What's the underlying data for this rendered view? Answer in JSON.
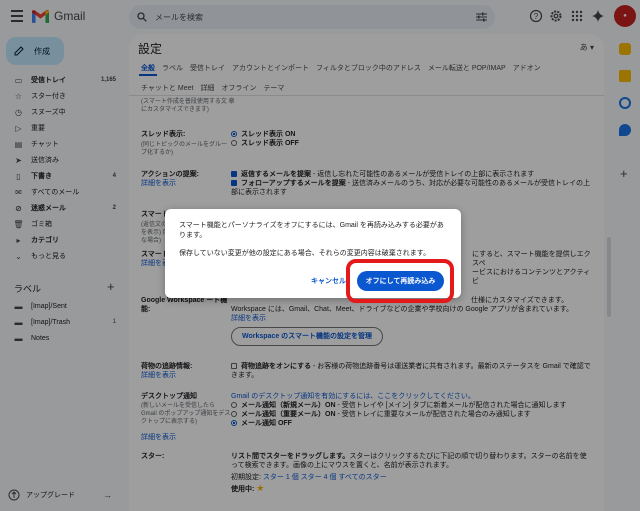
{
  "app": {
    "name": "Gmail"
  },
  "search": {
    "placeholder": "メールを検索"
  },
  "compose": {
    "label": "作成"
  },
  "nav": [
    {
      "label": "受信トレイ",
      "count": "1,165",
      "bold": true,
      "icon": "inbox-icon"
    },
    {
      "label": "スター付き",
      "count": "",
      "bold": false,
      "icon": "star-icon"
    },
    {
      "label": "スヌーズ中",
      "count": "",
      "bold": false,
      "icon": "clock-icon"
    },
    {
      "label": "重要",
      "count": "",
      "bold": false,
      "icon": "important-icon"
    },
    {
      "label": "チャット",
      "count": "",
      "bold": false,
      "icon": "chat-icon"
    },
    {
      "label": "送信済み",
      "count": "",
      "bold": false,
      "icon": "send-icon"
    },
    {
      "label": "下書き",
      "count": "4",
      "bold": true,
      "icon": "draft-icon"
    },
    {
      "label": "すべてのメール",
      "count": "",
      "bold": false,
      "icon": "mail-icon"
    },
    {
      "label": "迷惑メール",
      "count": "2",
      "bold": true,
      "icon": "spam-icon"
    },
    {
      "label": "ゴミ箱",
      "count": "",
      "bold": false,
      "icon": "trash-icon"
    },
    {
      "label": "カテゴリ",
      "count": "",
      "bold": true,
      "icon": "category-icon"
    },
    {
      "label": "もっと見る",
      "count": "",
      "bold": false,
      "icon": "chevron-down-icon"
    }
  ],
  "labels_section": {
    "title": "ラベル"
  },
  "labels": [
    {
      "label": "[Imap]/Sent",
      "count": ""
    },
    {
      "label": "[Imap]/Trash",
      "count": "1"
    },
    {
      "label": "Notes",
      "count": ""
    }
  ],
  "upgrade": {
    "label": "アップグレード"
  },
  "settings": {
    "title": "設定",
    "language": "あ",
    "tabs_row1": [
      "全般",
      "ラベル",
      "受信トレイ",
      "アカウントとインポート",
      "フィルタとブロック中のアドレス",
      "メール転送と POP/IMAP",
      "アドオン"
    ],
    "tabs_row2": [
      "チャットと Meet",
      "詳細",
      "オフライン",
      "テーマ"
    ],
    "smart_compose_note": "(スマート作成を普段使用する文 章にカスタマイズできます)",
    "thread": {
      "label": "スレッド表示:",
      "sub": "(同じトピックのメールをグループ化するか)",
      "on": "スレッド表示 ON",
      "off": "スレッド表示 OFF"
    },
    "nudges": {
      "label": "アクションの提案:",
      "link": "詳細を表示",
      "opt1_bold": "返信するメールを提案",
      "opt1_rest": " - 返信し忘れた可能性のあるメールが受信トレイの上部に表示されます",
      "opt2_bold": "フォローアップするメールを提案",
      "opt2_rest": " - 送信済みメールのうち、対応が必要な可能性のあるメールが受信トレイの上部に表示されます"
    },
    "smart_reply": {
      "label": "スマート リプ",
      "sub": "(返信文の候補を表示) 用可能な場合)"
    },
    "smart_features": {
      "label": "スマート機能",
      "link": "詳細を表示",
      "rest1": "にすると、スマート機能を提供しエクスペ",
      "rest2": "ービスにおけるコンテンツとアクティビ"
    },
    "workspace": {
      "label": "Google Workspace ート機能:",
      "line1": "仕様にカスタマイズできます。",
      "line2": "Workspace には、Gmail、Chat、Meet、ドライブなどの企業や学校向けの Google アプリが含まれています。",
      "link": "詳細を表示",
      "button": "Workspace のスマート機能の設定を管理"
    },
    "tracking": {
      "label": "荷物の追跡情報:",
      "link": "詳細を表示",
      "bold": "荷物追跡をオンにする",
      "rest": " - お客様の荷物追跡番号は運送業者に共有されます。最新のステータスを Gmail で確認できます。"
    },
    "desktop": {
      "label": "デスクトップ通知",
      "sub": "(新しいメールを受信したら Gmail のポップアップ通知をデスクトップに表示する)",
      "link": "詳細を表示",
      "enable_link": "Gmail のデスクトップ通知を有効にするには、ここをクリックしてください。",
      "opt1_bold": "メール通知（新規メール）ON",
      "opt1_rest": " - 受信トレイや [メイン] タブに新着メールが配信された場合に通知します",
      "opt2_bold": "メール通知（重要メール）ON",
      "opt2_rest": " - 受信トレイに重要なメールが配信された場合のみ通知します",
      "opt3_bold": "メール通知 OFF"
    },
    "stars": {
      "label": "スター:",
      "bold": "リスト間でスターをドラッグします。",
      "rest": "スターはクリックするたびに下記の順で切り替わります。スターの名前を使って検索できます。画像の上にマウスを置くと、名前が表示されます。",
      "preset_label": "初期設定:",
      "preset1": "スター 1 個",
      "preset2": "スター 4 個",
      "preset3": "すべてのスター",
      "in_use": "使用中:"
    }
  },
  "dialog": {
    "message1": "スマート機能とパーソナライズをオフにするには、Gmail を再読み込みする必要があります。",
    "message2": "保存していない変更が他の設定にある場合、それらの変更内容は破棄されます。",
    "cancel": "キャンセル",
    "confirm": "オフにして再読み込み"
  },
  "colors": {
    "accent": "#0b57d0",
    "highlight": "#e41a1a",
    "compose_bg": "#c2e7ff"
  }
}
